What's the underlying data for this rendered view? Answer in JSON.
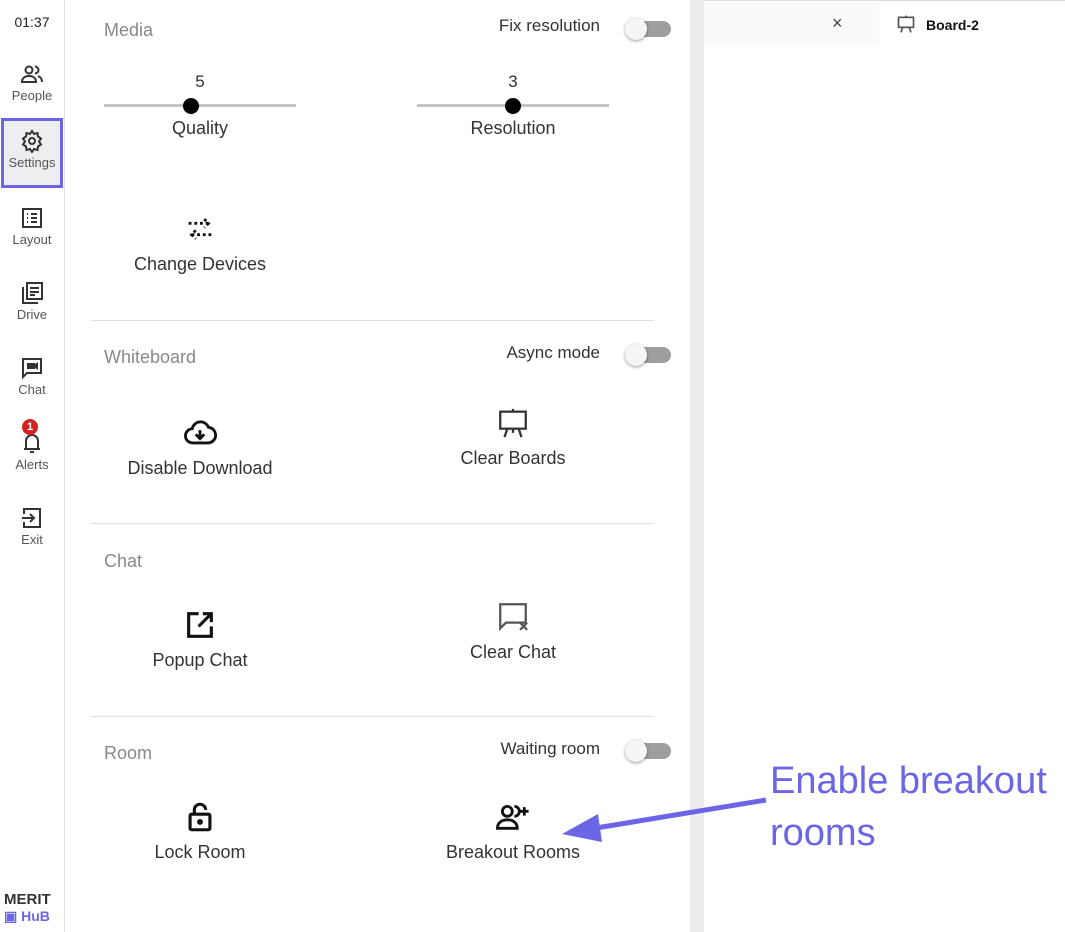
{
  "sidebar": {
    "time": "01:37",
    "items": [
      {
        "label": "People",
        "icon": "people-icon"
      },
      {
        "label": "Settings",
        "icon": "gear-icon",
        "active": true
      },
      {
        "label": "Layout",
        "icon": "layout-icon"
      },
      {
        "label": "Drive",
        "icon": "drive-icon"
      },
      {
        "label": "Chat",
        "icon": "chat-video-icon"
      },
      {
        "label": "Alerts",
        "icon": "bell-icon",
        "badge": "1"
      },
      {
        "label": "Exit",
        "icon": "exit-icon"
      }
    ],
    "logo": {
      "top": "MERIT",
      "bottom": "HuB"
    }
  },
  "media": {
    "title": "Media",
    "toggle_label": "Fix resolution",
    "toggle_on": false,
    "quality": {
      "label": "Quality",
      "value": "5"
    },
    "resolution": {
      "label": "Resolution",
      "value": "3"
    },
    "change_devices": "Change Devices"
  },
  "whiteboard": {
    "title": "Whiteboard",
    "toggle_label": "Async mode",
    "toggle_on": false,
    "disable_download": "Disable Download",
    "clear_boards": "Clear Boards"
  },
  "chat": {
    "title": "Chat",
    "popup_chat": "Popup Chat",
    "clear_chat": "Clear Chat"
  },
  "room": {
    "title": "Room",
    "toggle_label": "Waiting room",
    "toggle_on": false,
    "lock_room": "Lock Room",
    "breakout_rooms": "Breakout Rooms"
  },
  "tabs": {
    "close": "×",
    "board": "Board-2"
  },
  "annotation": {
    "text_1": "Enable breakout",
    "text_2": "rooms",
    "color": "#6a66e6"
  },
  "colors": {
    "accent": "#6a66e6",
    "badge": "#d32020"
  }
}
